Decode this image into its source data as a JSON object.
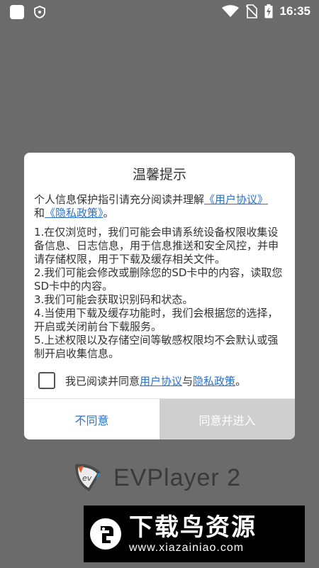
{
  "status_bar": {
    "time": "16:35",
    "icons": [
      "app-icon",
      "shield-icon",
      "wifi-icon",
      "no-sim-icon",
      "battery-charging-icon"
    ]
  },
  "dialog": {
    "title": "温馨提示",
    "intro_prefix": "个人信息保护指引请充分阅读并理解",
    "intro_link1": "《用户协议》",
    "intro_and": "和",
    "intro_link2": "《隐私政策》",
    "intro_suffix": "。",
    "points": [
      "1.在仅浏览时，我们可能会申请系统设备权限收集设备信息、日志信息，用于信息推送和安全风控，并申请存储权限，用于下载及缓存相关文件。",
      " 2.我们可能会修改或删除您的SD卡中的内容，读取您SD卡中的内容。",
      " 3.我们可能会获取识别码和状态。",
      " 4.当使用下载及缓存功能时，我们会根据您的选择，开启或关闭前台下载服务。",
      " 5.上述权限以及存储空间等敏感权限均不会默认或强制开启收集信息。"
    ],
    "agree_prefix": "我已阅读并同意",
    "agree_link1": "用户协议",
    "agree_and": "与",
    "agree_link2": "隐私政策",
    "agree_suffix": "。",
    "disagree_label": "不同意",
    "accept_label": "同意并进入"
  },
  "app_logo": {
    "name": "EVPlayer 2",
    "mark_text": "ev"
  },
  "watermark": {
    "title": "下载鸟资源",
    "url": "www.xiazainiao.com"
  },
  "colors": {
    "accent": "#2a6fd6",
    "overlay": "#6b6b6b",
    "accept_button_bg": "#cfcfcf"
  }
}
